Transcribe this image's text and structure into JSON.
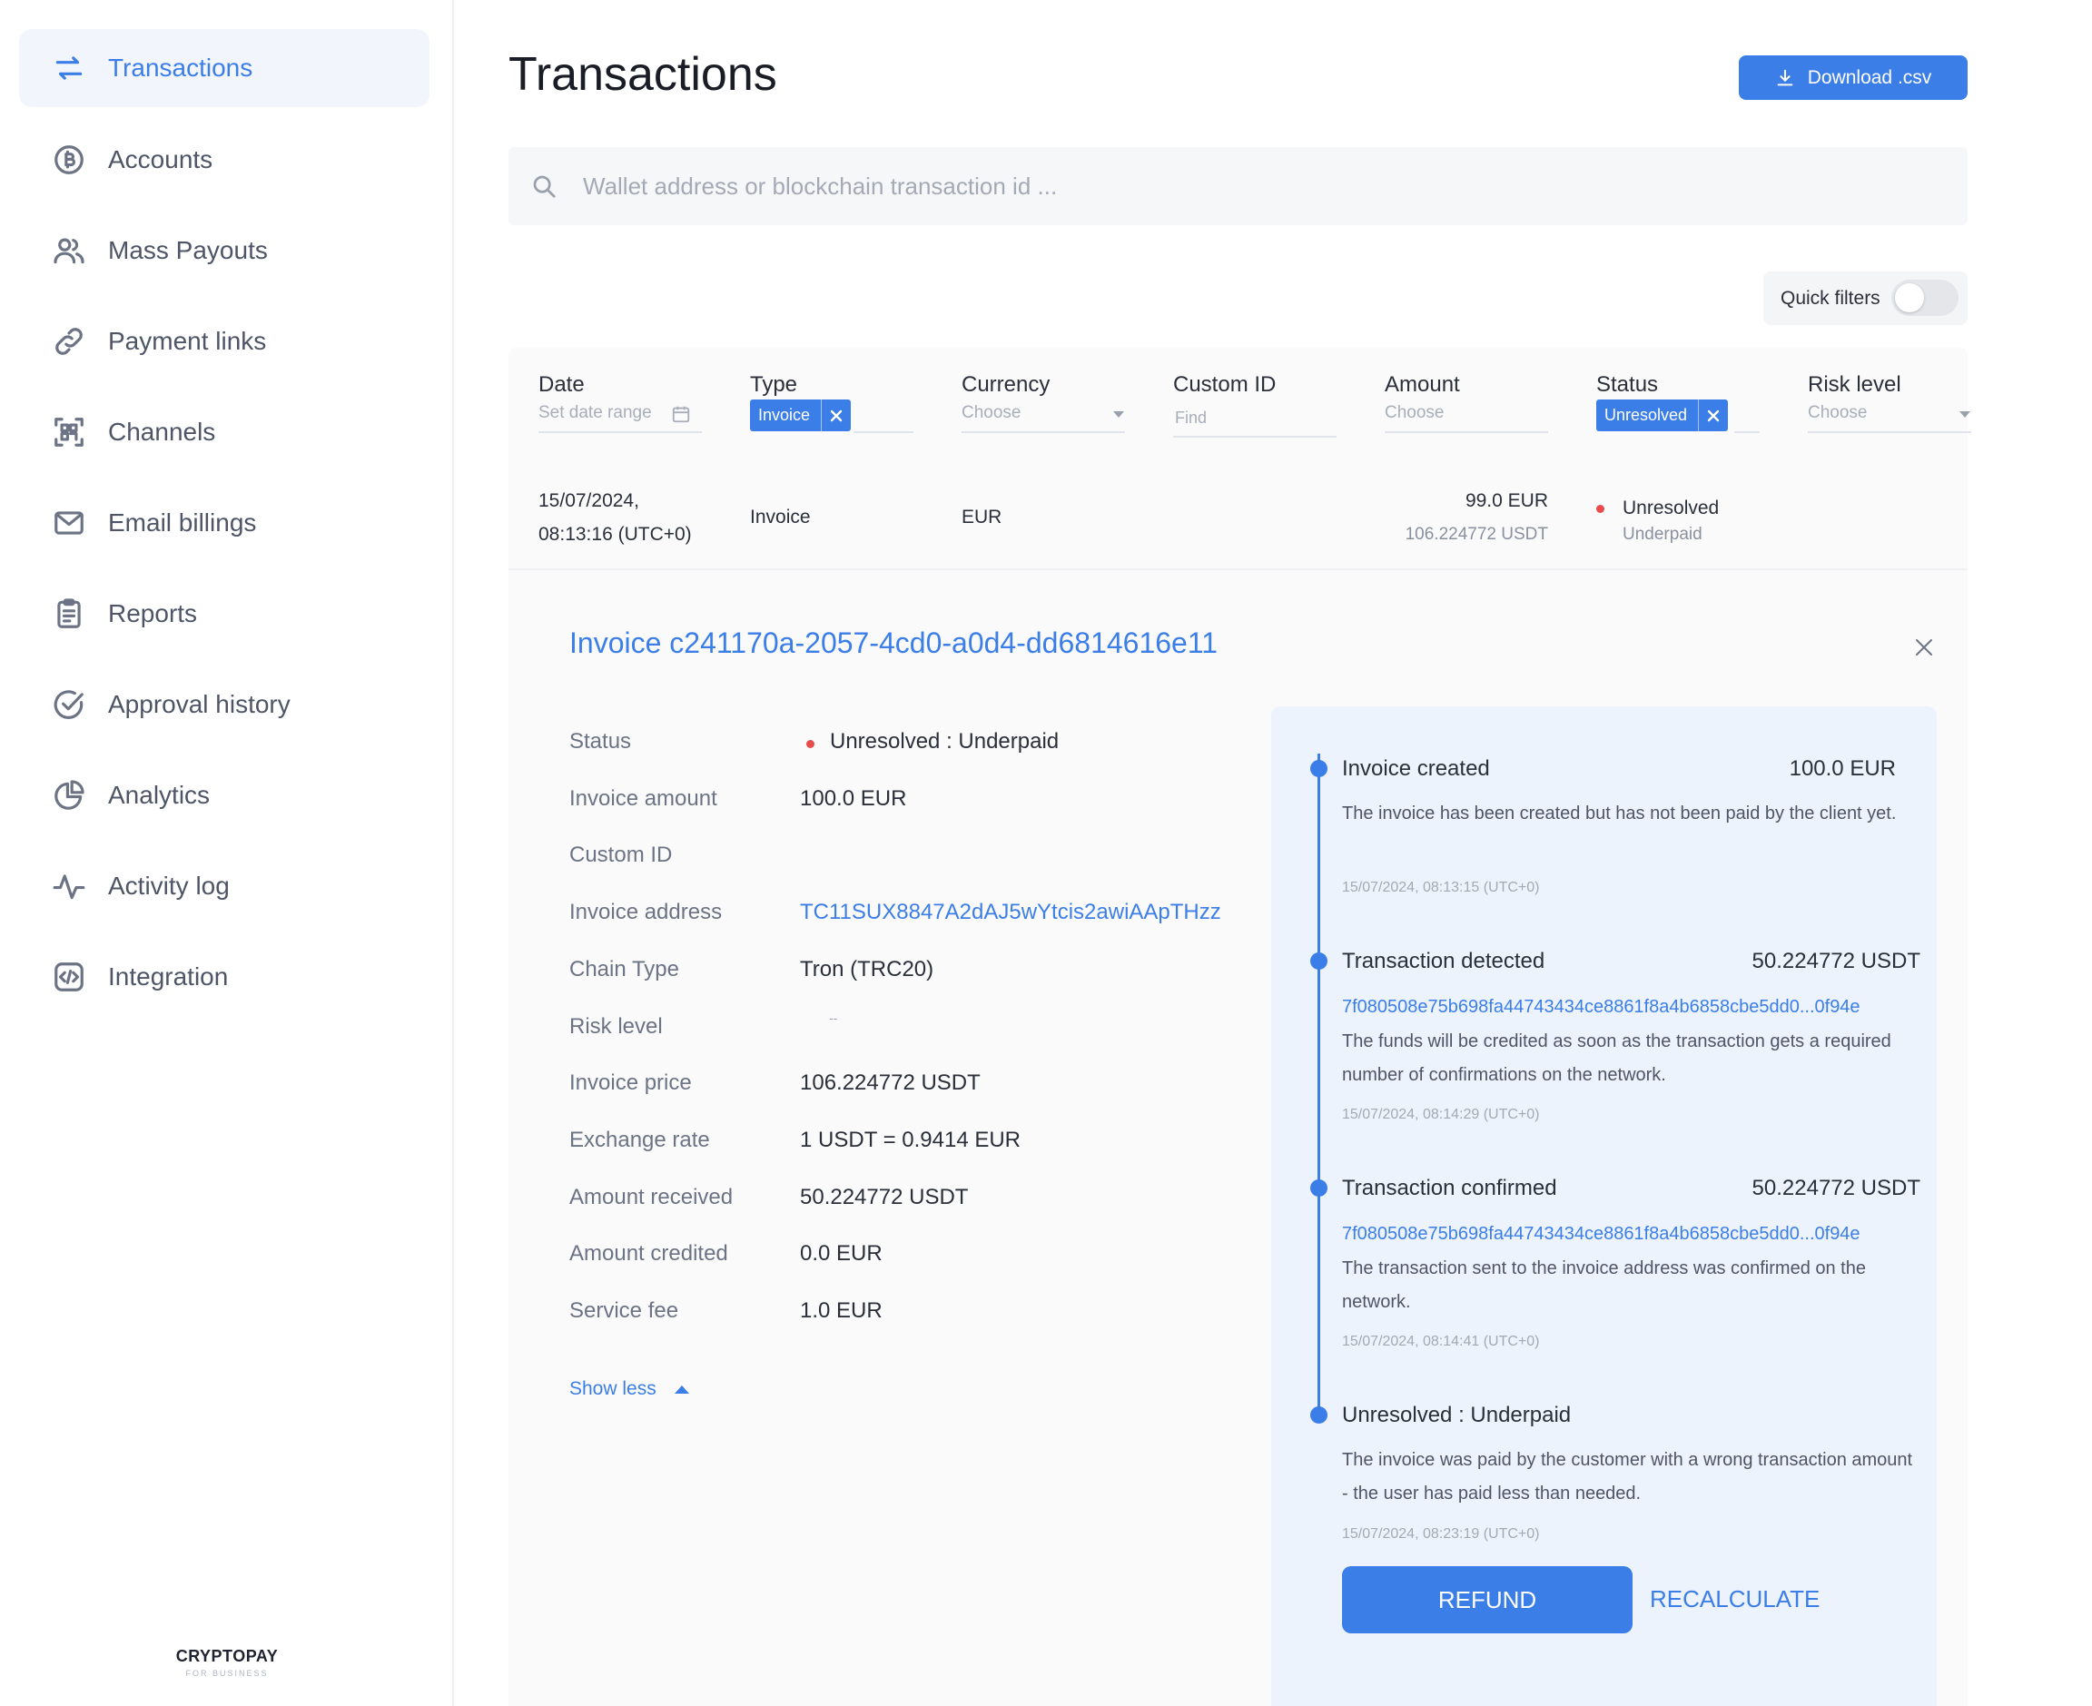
{
  "sidebar": {
    "items": [
      {
        "label": "Transactions",
        "icon": "arrows-exchange-icon",
        "active": true
      },
      {
        "label": "Accounts",
        "icon": "bitcoin-coin-icon"
      },
      {
        "label": "Mass Payouts",
        "icon": "users-icon"
      },
      {
        "label": "Payment links",
        "icon": "link-icon"
      },
      {
        "label": "Channels",
        "icon": "qr-scan-icon"
      },
      {
        "label": "Email billings",
        "icon": "envelope-icon"
      },
      {
        "label": "Reports",
        "icon": "clipboard-icon"
      },
      {
        "label": "Approval history",
        "icon": "check-circle-icon"
      },
      {
        "label": "Analytics",
        "icon": "pie-chart-icon"
      },
      {
        "label": "Activity log",
        "icon": "pulse-icon"
      },
      {
        "label": "Integration",
        "icon": "code-icon"
      }
    ],
    "brand": {
      "name": "CRYPTOPAY",
      "sub": "FOR BUSINESS"
    }
  },
  "header": {
    "title": "Transactions",
    "download_label": "Download .csv"
  },
  "search": {
    "placeholder": "Wallet address or blockchain transaction id ..."
  },
  "quick_filters": {
    "label": "Quick filters",
    "enabled": false
  },
  "table": {
    "columns": {
      "date": {
        "header": "Date",
        "filter": "Set date range"
      },
      "type": {
        "header": "Type",
        "chip": "Invoice"
      },
      "currency": {
        "header": "Currency",
        "filter": "Choose"
      },
      "custom_id": {
        "header": "Custom ID",
        "filter": "Find"
      },
      "amount": {
        "header": "Amount",
        "filter": "Choose"
      },
      "status": {
        "header": "Status",
        "chip": "Unresolved"
      },
      "risk": {
        "header": "Risk level",
        "filter": "Choose"
      }
    },
    "row": {
      "date_line1": "15/07/2024,",
      "date_line2": "08:13:16 (UTC+0)",
      "type": "Invoice",
      "currency": "EUR",
      "amount": "99.0 EUR",
      "amount_sub": "106.224772 USDT",
      "status": "Unresolved",
      "status_sub": "Underpaid"
    }
  },
  "detail": {
    "title": "Invoice c241170a-2057-4cd0-a0d4-dd6814616e11",
    "show_less": "Show less",
    "fields": {
      "status": {
        "key": "Status",
        "value": "Unresolved : Underpaid"
      },
      "invoice_amount": {
        "key": "Invoice amount",
        "value": "100.0 EUR"
      },
      "custom_id": {
        "key": "Custom ID",
        "value": ""
      },
      "invoice_address": {
        "key": "Invoice address",
        "value": "TC11SUX8847A2dAJ5wYtcis2awiAApTHzz"
      },
      "chain_type": {
        "key": "Chain Type",
        "value": "Tron (TRC20)"
      },
      "risk_level": {
        "key": "Risk level",
        "value": "--"
      },
      "invoice_price": {
        "key": "Invoice price",
        "value": "106.224772 USDT"
      },
      "exchange_rate": {
        "key": "Exchange rate",
        "value": "1 USDT = 0.9414 EUR"
      },
      "amount_received": {
        "key": "Amount received",
        "value": "50.224772 USDT"
      },
      "amount_credited": {
        "key": "Amount credited",
        "value": "0.0 EUR"
      },
      "service_fee": {
        "key": "Service fee",
        "value": "1.0 EUR"
      }
    },
    "timeline": {
      "created": {
        "title": "Invoice created",
        "amount": "100.0 EUR",
        "desc": "The invoice has been created but has not been paid by the client yet.",
        "time": "15/07/2024, 08:13:15 (UTC+0)"
      },
      "detected": {
        "title": "Transaction detected",
        "amount": "50.224772 USDT",
        "hash": "7f080508e75b698fa44743434ce8861f8a4b6858cbe5dd0...0f94e",
        "desc": "The funds will be credited as soon as the transaction gets a required number of confirmations on the network.",
        "time": "15/07/2024, 08:14:29 (UTC+0)"
      },
      "confirmed": {
        "title": "Transaction confirmed",
        "amount": "50.224772 USDT",
        "hash": "7f080508e75b698fa44743434ce8861f8a4b6858cbe5dd0...0f94e",
        "desc": "The transaction sent to the invoice address was confirmed on the network.",
        "time": "15/07/2024, 08:14:41 (UTC+0)"
      },
      "underpaid": {
        "title": "Unresolved : Underpaid",
        "desc": "The invoice was paid by the customer with a wrong transaction amount - the user has paid less than needed.",
        "time": "15/07/2024, 08:23:19 (UTC+0)"
      }
    },
    "actions": {
      "refund": "REFUND",
      "recalculate": "RECALCULATE"
    }
  },
  "colors": {
    "accent": "#3b7ee8",
    "status_red": "#e94b4b",
    "timeline_bg": "#edf3fc"
  }
}
